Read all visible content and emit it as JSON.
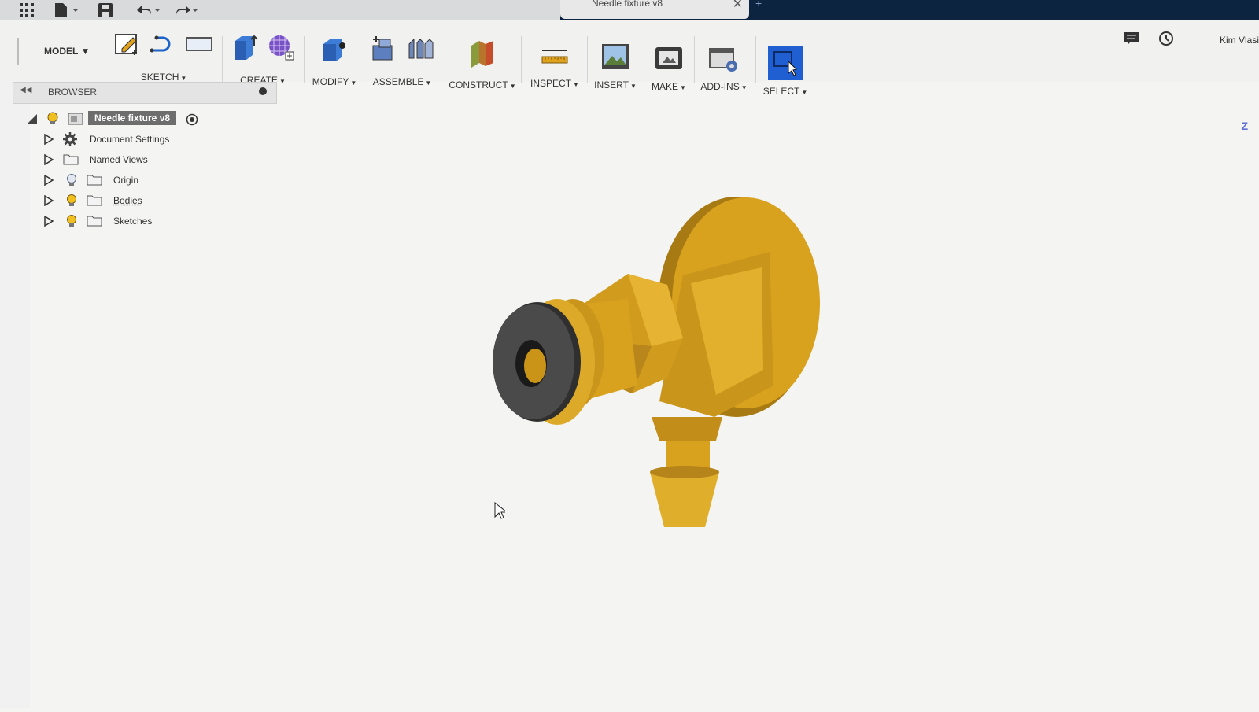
{
  "app": {
    "document_tab_title": "Needle fixture v8",
    "user_name": "Kim Vlasi"
  },
  "ribbon": {
    "workspace": "MODEL",
    "groups": [
      {
        "id": "sketch",
        "label": "SKETCH"
      },
      {
        "id": "create",
        "label": "CREATE"
      },
      {
        "id": "modify",
        "label": "MODIFY"
      },
      {
        "id": "assemble",
        "label": "ASSEMBLE"
      },
      {
        "id": "construct",
        "label": "CONSTRUCT"
      },
      {
        "id": "inspect",
        "label": "INSPECT"
      },
      {
        "id": "insert",
        "label": "INSERT"
      },
      {
        "id": "make",
        "label": "MAKE"
      },
      {
        "id": "addins",
        "label": "ADD-INS"
      },
      {
        "id": "select",
        "label": "SELECT"
      }
    ],
    "select_accent": "#1f5fd1"
  },
  "browser": {
    "header": "BROWSER",
    "root": "Needle fixture v8",
    "items": [
      {
        "label": "Document Settings",
        "icon": "gear-icon"
      },
      {
        "label": "Named Views",
        "icon": "folder-icon"
      },
      {
        "label": "Origin",
        "icon": "folder-icon",
        "bulb": "off"
      },
      {
        "label": "Bodies",
        "icon": "folder-icon",
        "bulb": "on"
      },
      {
        "label": "Sketches",
        "icon": "folder-icon",
        "bulb": "on"
      }
    ]
  },
  "viewport": {
    "axis_label": "Z",
    "model_colors": {
      "body": "#d8a21f",
      "body_dark": "#a87a14",
      "face_light": "#e7b733",
      "gasket": "#3f3f3f"
    }
  }
}
